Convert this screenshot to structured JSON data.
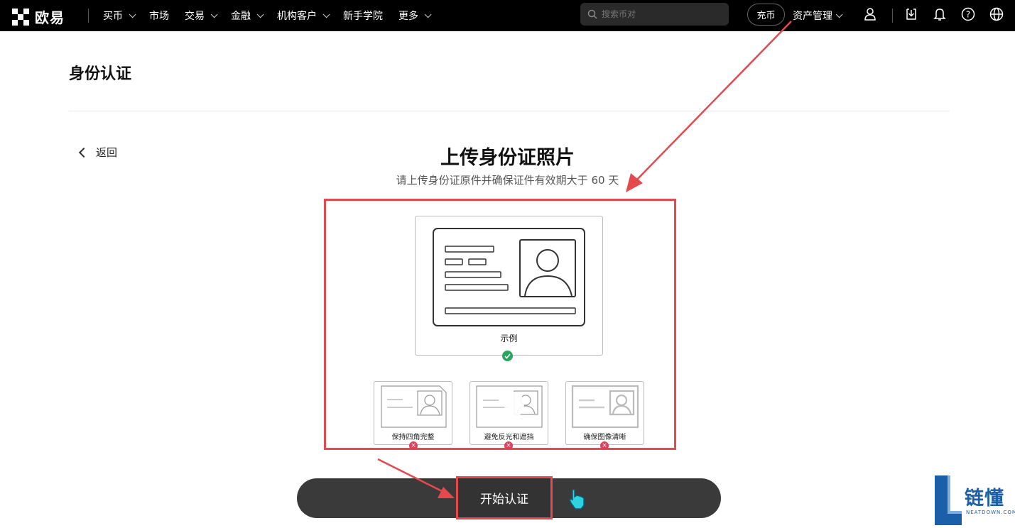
{
  "brand": {
    "name": "欧易"
  },
  "nav": {
    "items": [
      {
        "label": "买币",
        "dropdown": true
      },
      {
        "label": "市场",
        "dropdown": false
      },
      {
        "label": "交易",
        "dropdown": true
      },
      {
        "label": "金融",
        "dropdown": true
      },
      {
        "label": "机构客户",
        "dropdown": true
      },
      {
        "label": "新手学院",
        "dropdown": false
      },
      {
        "label": "更多",
        "dropdown": true
      }
    ]
  },
  "search": {
    "placeholder": "搜索币对"
  },
  "header_actions": {
    "deposit_label": "充币",
    "assets_label": "资产管理"
  },
  "page": {
    "title": "身份认证",
    "back_label": "返回",
    "heading": "上传身份证照片",
    "subheading": "请上传身份证原件并确保证件有效期大于 60 天"
  },
  "examples": {
    "sample_label": "示例",
    "bad_items": [
      {
        "label": "保持四角完整"
      },
      {
        "label": "避免反光和遮挡"
      },
      {
        "label": "确保图像清晰"
      }
    ]
  },
  "actions": {
    "start_label": "开始认证"
  },
  "watermark": {
    "text": "链懂",
    "sub": "NEATDOWN.COM"
  },
  "colors": {
    "accent_red": "#e5484d",
    "success_green": "#26a65b",
    "error_red": "#e0405a",
    "topbar_bg": "#000000",
    "button_bg": "#3a3a3a"
  }
}
